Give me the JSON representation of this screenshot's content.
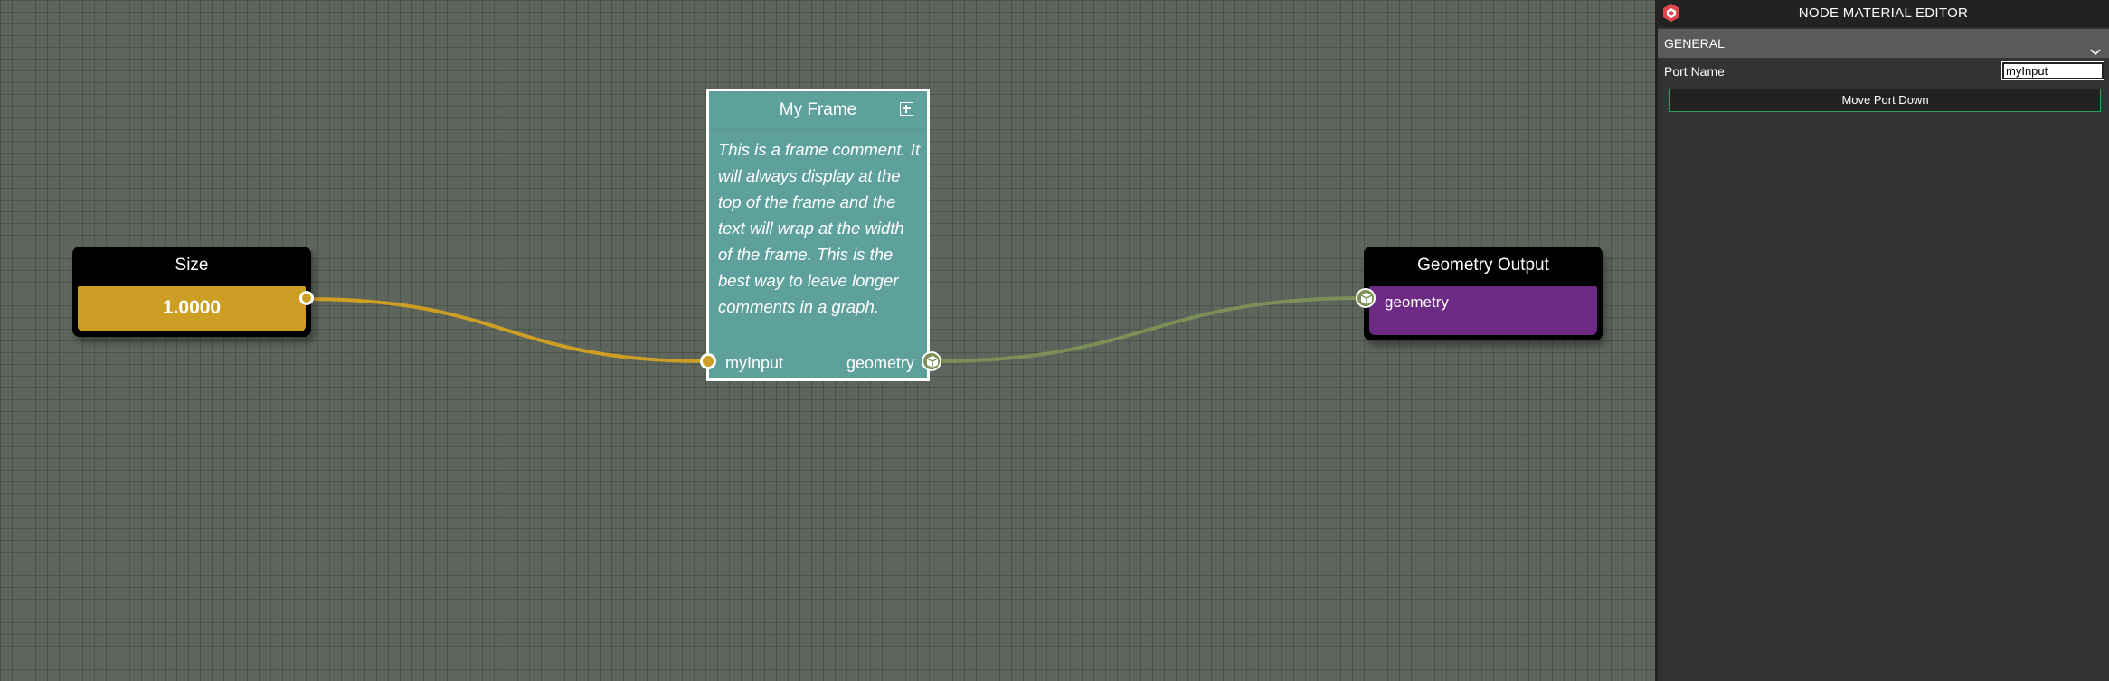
{
  "canvas": {
    "size_node": {
      "title": "Size",
      "value": "1.0000"
    },
    "frame": {
      "title": "My Frame",
      "comment": "This is a frame comment. It will always display at the top of the frame and the text will wrap at the width of the frame. This is the best way to leave longer comments in a graph.",
      "input_port": "myInput",
      "output_port": "geometry"
    },
    "geometry_node": {
      "title": "Geometry Output",
      "port": "geometry"
    }
  },
  "panel": {
    "title": "NODE MATERIAL EDITOR",
    "section": "GENERAL",
    "port_name_label": "Port Name",
    "port_name_value": "myInput",
    "move_button": "Move Port Down"
  },
  "colors": {
    "float_link": "#cc9e24",
    "geometry_link": "#7c8f56",
    "frame_fill": "#5ea19c",
    "geometry_node_body": "#6c2a85",
    "button_border": "#2f9e56"
  }
}
